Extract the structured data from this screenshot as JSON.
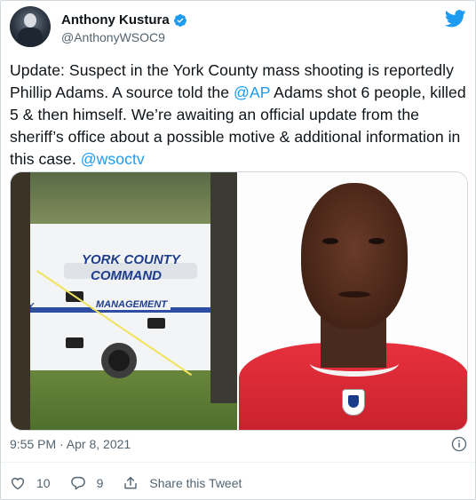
{
  "author": {
    "name": "Anthony Kustura",
    "handle": "@AnthonyWSOC9",
    "verified": true
  },
  "tweet": {
    "segments": [
      {
        "text": "Update: Suspect in the York County mass shooting is reportedly Phillip Adams. A source told the ",
        "link": false
      },
      {
        "text": "@AP",
        "link": true
      },
      {
        "text": " Adams shot 6 people, killed 5 & then himself. We’re awaiting an official update from the sheriff’s office about a possible motive & additional information in this case. ",
        "link": false
      },
      {
        "text": "@wsoctv",
        "link": true
      }
    ]
  },
  "media": {
    "left_photo": {
      "line1": "YORK COUNTY",
      "line2": "COMMAND",
      "stripe_text": "MANAGEMENT",
      "stripe_left": "CY"
    }
  },
  "meta": {
    "timestamp": "9:55 PM · Apr 8, 2021"
  },
  "actions": {
    "likes": "10",
    "replies": "9",
    "share_label": "Share this Tweet"
  },
  "colors": {
    "link": "#1d9bf0",
    "secondary_text": "#536471",
    "twitter_blue": "#1d9bf0"
  },
  "icons": [
    "verified-badge-icon",
    "twitter-bird-icon",
    "info-icon",
    "heart-icon",
    "reply-icon",
    "share-icon"
  ]
}
